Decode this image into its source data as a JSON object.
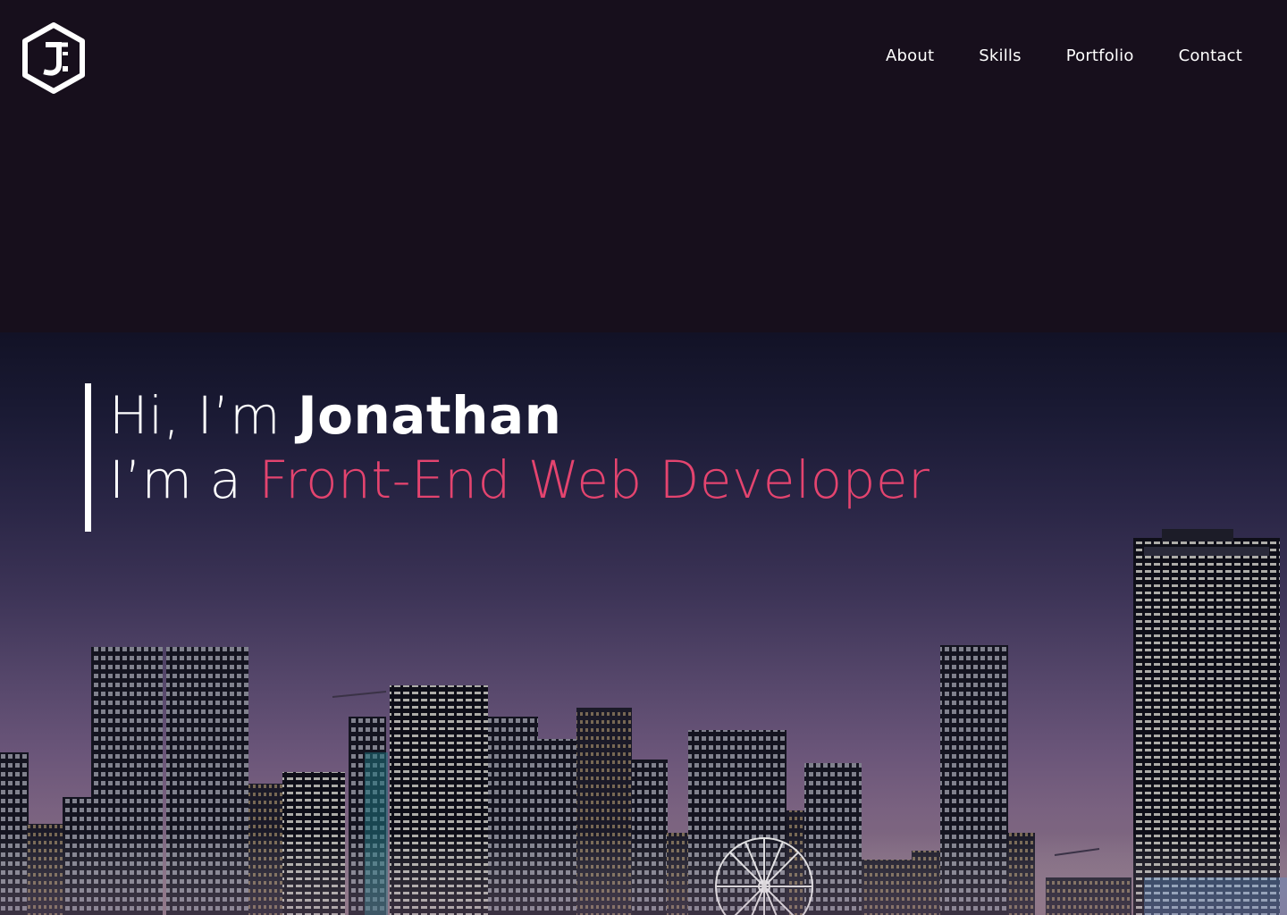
{
  "header": {
    "logo_icon": "hexagon-jf-logo",
    "nav": [
      {
        "label": "About"
      },
      {
        "label": "Skills"
      },
      {
        "label": "Portfolio"
      },
      {
        "label": "Contact"
      }
    ]
  },
  "hero": {
    "greeting_prefix": "Hi, I’m ",
    "name": "Jonathan",
    "role_prefix": "I’m a ",
    "role": "Front-End Web Developer",
    "accent_color": "#e4446f",
    "background_image": "night-city-skyline"
  }
}
